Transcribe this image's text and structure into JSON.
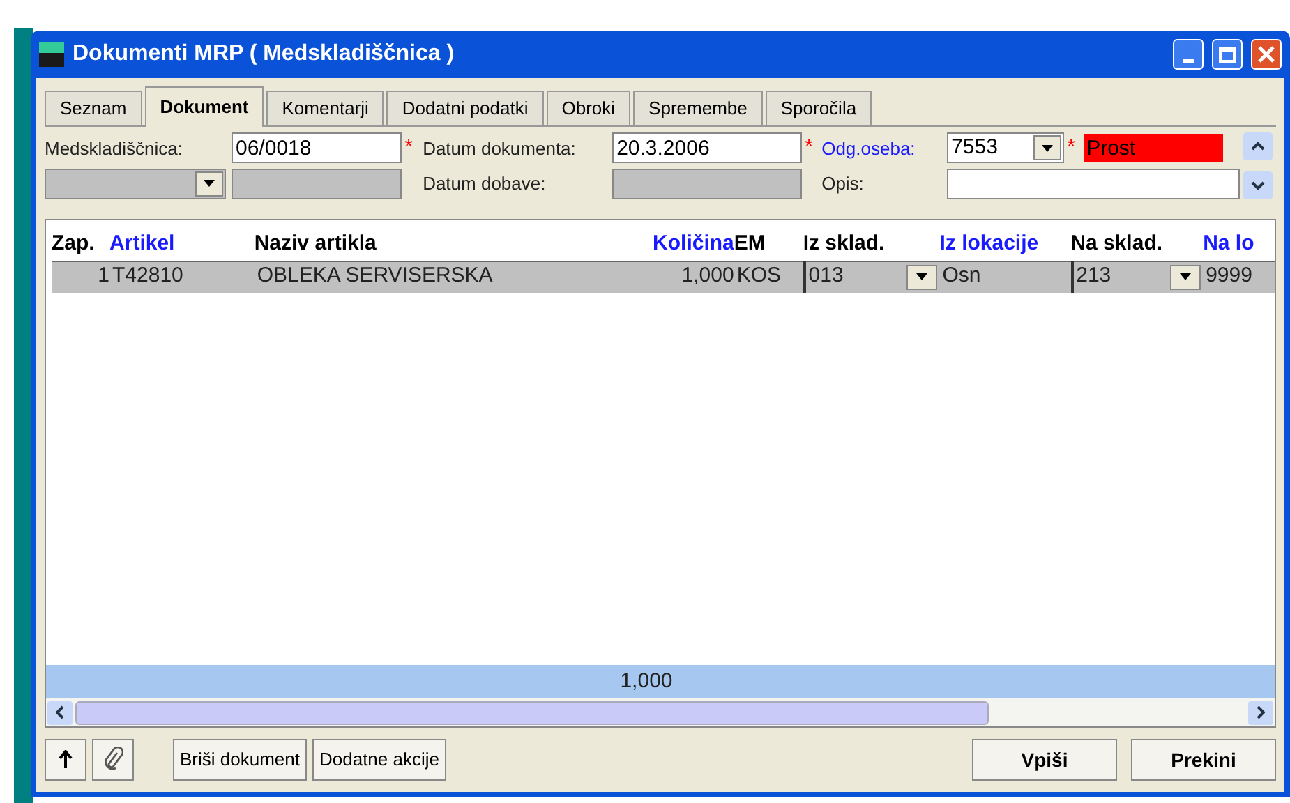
{
  "window": {
    "title": "Dokumenti MRP ( Medskladiščnica )"
  },
  "tabs": [
    {
      "label": "Seznam",
      "selected": false
    },
    {
      "label": "Dokument",
      "selected": true
    },
    {
      "label": "Komentarji",
      "selected": false
    },
    {
      "label": "Dodatni podatki",
      "selected": false
    },
    {
      "label": "Obroki",
      "selected": false
    },
    {
      "label": "Spremembe",
      "selected": false
    },
    {
      "label": "Sporočila",
      "selected": false
    }
  ],
  "form": {
    "medskladiscnica": {
      "label": "Medskladiščnica:",
      "value": "06/0018",
      "required_mark": "*"
    },
    "datum_dokumenta": {
      "label": "Datum dokumenta:",
      "value": "20.3.2006",
      "required_mark": "*"
    },
    "datum_dobave": {
      "label": "Datum dobave:"
    },
    "odg_oseba": {
      "label": "Odg.oseba:",
      "value": "7553",
      "required_mark": "*"
    },
    "status": {
      "value": "Prost"
    },
    "opis": {
      "label": "Opis:"
    }
  },
  "table": {
    "columns": [
      {
        "label": "Zap.",
        "link": false
      },
      {
        "label": "Artikel",
        "link": true
      },
      {
        "label": "Naziv artikla",
        "link": false
      },
      {
        "label": "Količina",
        "link": true
      },
      {
        "label": "EM",
        "link": false
      },
      {
        "label": "Iz sklad.",
        "link": false
      },
      {
        "label": "Iz lokacije",
        "link": true
      },
      {
        "label": "Na sklad.",
        "link": false
      },
      {
        "label": "Na lo",
        "link": true
      }
    ],
    "rows": [
      {
        "cells": [
          {
            "kind": "number",
            "text": "1"
          },
          {
            "kind": "text",
            "text": "T42810"
          },
          {
            "kind": "text",
            "text": "OBLEKA  SERVISERSKA"
          },
          {
            "kind": "number",
            "text": "1,000"
          },
          {
            "kind": "text",
            "text": "KOS"
          },
          {
            "kind": "dropdown",
            "text": "013"
          },
          {
            "kind": "text",
            "text": "Osn"
          },
          {
            "kind": "dropdown",
            "text": "213"
          },
          {
            "kind": "text",
            "text": "9999"
          }
        ]
      }
    ],
    "total": "1,000"
  },
  "buttons": {
    "left": [
      "Briši dokument",
      "Dodatne akcije"
    ],
    "right": [
      "Vpiši",
      "Prekini"
    ]
  }
}
